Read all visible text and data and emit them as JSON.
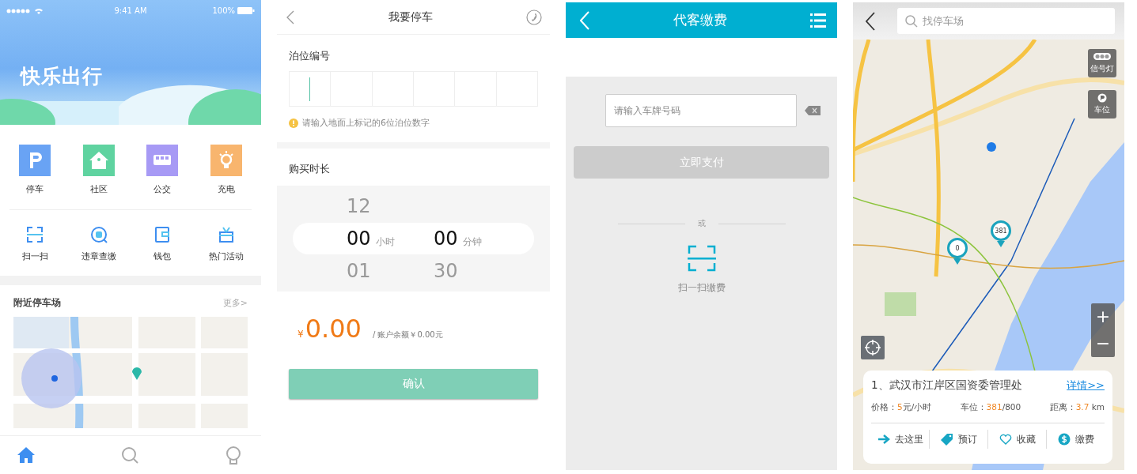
{
  "home": {
    "status_bar": {
      "time": "9:41 AM",
      "battery": "100%"
    },
    "banner": {
      "title": "快乐出行"
    },
    "services": [
      {
        "kind": "parking",
        "label": "停车",
        "color": "#69a3f4"
      },
      {
        "kind": "community",
        "label": "社区",
        "color": "#5fd3a0"
      },
      {
        "kind": "bus",
        "label": "公交",
        "color": "#a79af5"
      },
      {
        "kind": "charging",
        "label": "充电",
        "color": "#f8b56e"
      }
    ],
    "shortcuts": [
      {
        "kind": "scan",
        "label": "扫一扫"
      },
      {
        "kind": "violation",
        "label": "违章查缴"
      },
      {
        "kind": "wallet",
        "label": "钱包"
      },
      {
        "kind": "gift",
        "label": "热门活动"
      }
    ],
    "nearby": {
      "title": "附近停车场",
      "more": "更多>"
    },
    "tabs": [
      {
        "kind": "home",
        "selected": true
      },
      {
        "kind": "search",
        "selected": false
      },
      {
        "kind": "profile",
        "selected": false
      }
    ]
  },
  "parking": {
    "title": "我要停车",
    "berth_label": "泊位编号",
    "berth_cells": [
      {
        "focused": true
      },
      {
        "focused": false
      },
      {
        "focused": false
      },
      {
        "focused": false
      },
      {
        "focused": false
      },
      {
        "focused": false
      }
    ],
    "hint": "请输入地面上标记的6位泊位数字",
    "duration_label": "购买时长",
    "picker": [
      {
        "above": "12",
        "value": "00",
        "unit": "小时",
        "below": "01"
      },
      {
        "value": "00",
        "unit": "分钟",
        "below": "30"
      }
    ],
    "amount": {
      "currency": "¥",
      "value": "0.00",
      "balance": "/ 账户余额￥0.00元"
    },
    "confirm": "确认"
  },
  "pay": {
    "title": "代客缴费",
    "plate_placeholder": "请输入车牌号码",
    "pay_button": "立即支付",
    "pay_disabled": true,
    "divider": "或",
    "scan_label": "扫一扫缴费"
  },
  "map": {
    "search_placeholder": "找停车场",
    "layers": [
      {
        "kind": "traffic",
        "label": "信号灯"
      },
      {
        "kind": "parking",
        "label": "车位"
      }
    ],
    "pins": [
      {
        "label": "381"
      },
      {
        "label": "0"
      }
    ],
    "zoom": {
      "in": "+",
      "out": "−"
    },
    "lot": {
      "name": "1、武汉市江岸区国资委管理处",
      "details_link": "详情>>",
      "stats": [
        {
          "label": "价格：",
          "value": "5",
          "unit": "元/小时"
        },
        {
          "label": "车位：",
          "value": "381",
          "unit": "/800"
        },
        {
          "label": "距离：",
          "value": "3.7",
          "unit": " km"
        }
      ]
    },
    "actions": [
      {
        "kind": "navigate",
        "label": "去这里"
      },
      {
        "kind": "reserve",
        "label": "预订"
      },
      {
        "kind": "favorite",
        "label": "收藏"
      },
      {
        "kind": "pay",
        "label": "缴费"
      }
    ]
  }
}
